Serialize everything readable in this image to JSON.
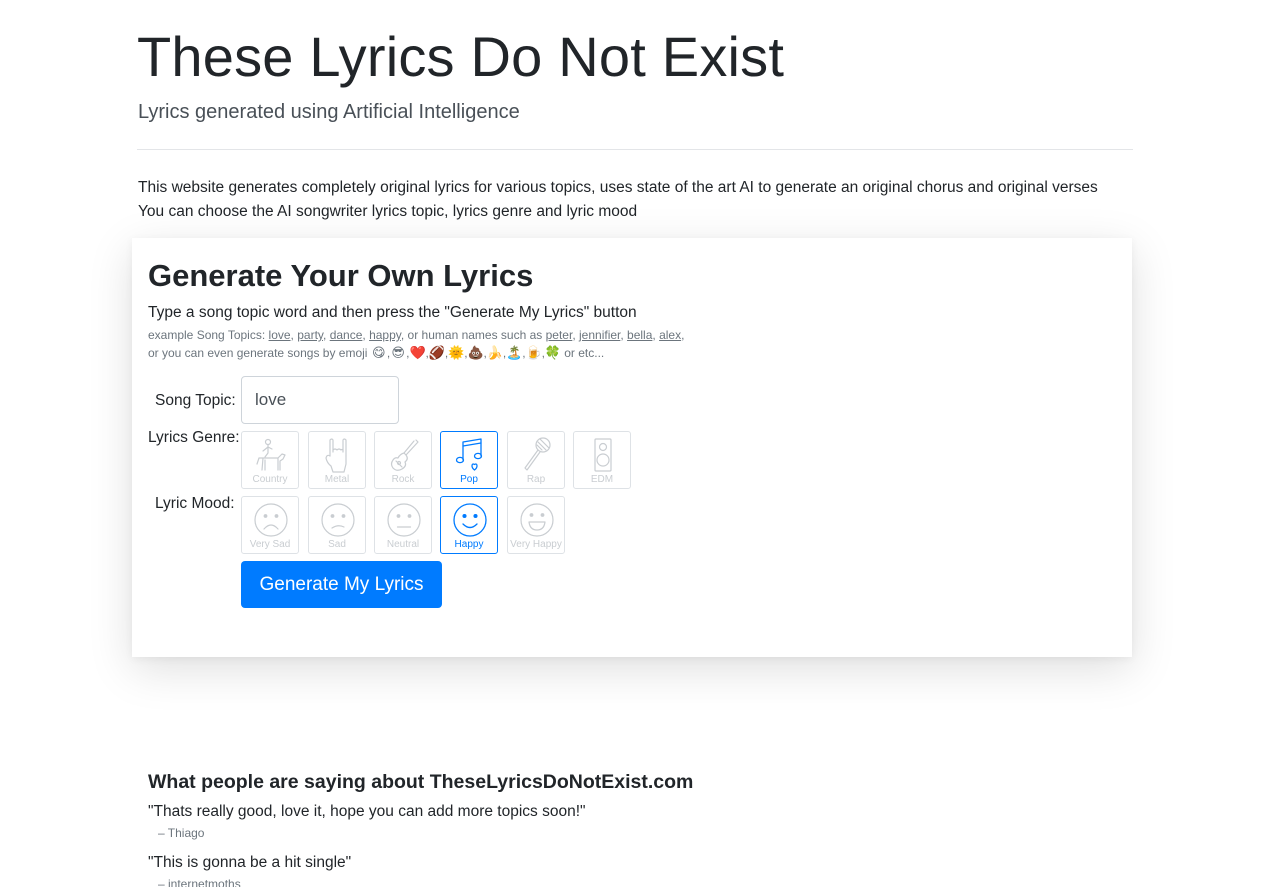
{
  "header": {
    "title": "These Lyrics Do Not Exist",
    "subtitle": "Lyrics generated using Artificial Intelligence"
  },
  "intro": {
    "line1": "This website generates completely original lyrics for various topics, uses state of the art AI to generate an original chorus and original verses",
    "line2": "You can choose the AI songwriter lyrics topic, lyrics genre and lyric mood"
  },
  "generator": {
    "title": "Generate Your Own Lyrics",
    "instruction": "Type a song topic word and then press the \"Generate My Lyrics\" button",
    "example_prefix": "example Song Topics:",
    "example_topics": [
      "love",
      "party",
      "dance",
      "happy"
    ],
    "example_middle": ", or human names such as",
    "example_names": [
      "peter",
      "jennifier",
      "bella",
      "alex"
    ],
    "emoji_prefix": "or you can even generate songs by emoji",
    "emojis": [
      "😋",
      "😎",
      "❤️",
      "🏈",
      "🌞",
      "💩",
      "🍌",
      "🏝️",
      "🍺",
      "🍀"
    ],
    "emoji_suffix": "or etc...",
    "topic_label": "Song Topic:",
    "topic_value": "love",
    "genre_label": "Lyrics Genre:",
    "genres": [
      {
        "label": "Country",
        "icon": "horse-rider-icon",
        "selected": false
      },
      {
        "label": "Metal",
        "icon": "rock-hand-icon",
        "selected": false
      },
      {
        "label": "Rock",
        "icon": "electric-guitar-icon",
        "selected": false
      },
      {
        "label": "Pop",
        "icon": "music-notes-icon",
        "selected": true
      },
      {
        "label": "Rap",
        "icon": "microphone-icon",
        "selected": false
      },
      {
        "label": "EDM",
        "icon": "speaker-icon",
        "selected": false
      }
    ],
    "mood_label": "Lyric Mood:",
    "moods": [
      {
        "label": "Very Sad",
        "icon": "very-sad-face-icon",
        "selected": false
      },
      {
        "label": "Sad",
        "icon": "sad-face-icon",
        "selected": false
      },
      {
        "label": "Neutral",
        "icon": "neutral-face-icon",
        "selected": false
      },
      {
        "label": "Happy",
        "icon": "happy-face-icon",
        "selected": true
      },
      {
        "label": "Very Happy",
        "icon": "very-happy-face-icon",
        "selected": false
      }
    ],
    "button_label": "Generate My Lyrics"
  },
  "testimonials": {
    "title": "What people are saying about TheseLyricsDoNotExist.com",
    "items": [
      {
        "quote": "\"Thats really good, love it, hope you can add more topics soon!\"",
        "author": "– Thiago"
      },
      {
        "quote": "\"This is gonna be a hit single\"",
        "author": "– internetmoths"
      }
    ]
  },
  "colors": {
    "primary": "#007bff",
    "muted": "#6c757d",
    "inactive_icon": "#c9cdd1"
  }
}
